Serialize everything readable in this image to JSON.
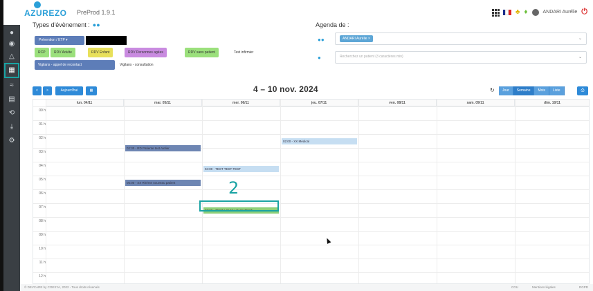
{
  "header": {
    "logo": "AZUREZO",
    "environment": "PreProd 1.9.1",
    "user": "ANDARI Aurélie",
    "flag_colors": [
      "#1a2e8c",
      "#ffffff",
      "#d22"
    ]
  },
  "types": {
    "title": "Types d'évènement :",
    "filter_label": "Prévention / ETP",
    "chips": [
      {
        "label": "RCP",
        "color": "#9be07c"
      },
      {
        "label": "RDV Adulte",
        "color": "#9be07c"
      },
      {
        "label": "RDV Enfant",
        "color": "#e8e05a"
      },
      {
        "label": "RDV Personnes agées",
        "color": "#c98be0"
      },
      {
        "label": "RDV sans patient",
        "color": "#9be07c"
      },
      {
        "label": "Test infirmier",
        "color": "#ffffff"
      }
    ],
    "chips_row2": [
      {
        "label": "Vigilans - appel de recontact",
        "color": "#5d7db8"
      },
      {
        "label": "Vigilans - consultation",
        "color": "#ffffff"
      }
    ]
  },
  "agenda": {
    "title": "Agenda de :",
    "selected": "ANDARI Aurélie",
    "patient_placeholder": "Recherchez un patient (3 caractères min)"
  },
  "toolbar": {
    "prev": "<",
    "next": ">",
    "today": "Aujourd'hui",
    "range_title": "4 – 10 nov. 2024",
    "views": [
      "Jour",
      "Semaine",
      "Mois",
      "Liste"
    ],
    "active_view": "Semaine"
  },
  "calendar": {
    "days": [
      "lun. 04/11",
      "mar. 05/11",
      "mer. 06/11",
      "jeu. 07/11",
      "ven. 08/11",
      "sam. 09/11",
      "dim. 10/11"
    ],
    "hours": [
      "00 h",
      "01 h",
      "02 h",
      "03 h",
      "04 h",
      "05 h",
      "06 h",
      "07 h",
      "08 h",
      "09 h",
      "10 h",
      "11 h",
      "12 h"
    ],
    "events": [
      {
        "day": 1,
        "hour": 2.5,
        "text": "02:30 - RD Patiente test Atelier",
        "color": "#6e86b3"
      },
      {
        "day": 3,
        "hour": 2,
        "text": "02:00 - XX Médical",
        "color": "#c6def2"
      },
      {
        "day": 2,
        "hour": 4,
        "text": "04:00 - TEST TEST-TEST",
        "color": "#c6def2"
      },
      {
        "day": 1,
        "hour": 5,
        "text": "05:00 - XX Rhéme nouveau patient",
        "color": "#6e86b3"
      },
      {
        "day": 2,
        "hour": 7,
        "text": "07:00 - TEST LOUIS LOUIS TEST",
        "color": "#8fd07a"
      }
    ]
  },
  "annotation_number": "2",
  "footer": {
    "copyright": "© DEVCARE by COEXYA, 2022 - Tous droits réservés",
    "links": [
      "CGU",
      "Mentions légales",
      "RGPD"
    ]
  }
}
